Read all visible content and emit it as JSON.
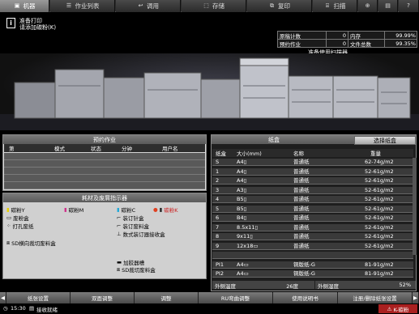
{
  "tabs": [
    {
      "label": "机器",
      "icon": "machine-icon"
    },
    {
      "label": "作业列表",
      "icon": "list-icon"
    },
    {
      "label": "调用",
      "icon": "recall-icon"
    },
    {
      "label": "存储",
      "icon": "store-icon"
    },
    {
      "label": "复印",
      "icon": "copy-icon"
    },
    {
      "label": "扫描",
      "icon": "scan-icon"
    }
  ],
  "message": {
    "line1": "准备打印",
    "line2": "请添加碳粉(K)"
  },
  "stats": {
    "orig_label": "原稿计数",
    "orig_value": "0",
    "mem_label": "内存",
    "mem_value": "99.99%",
    "reserve_label": "预约作业",
    "reserve_value": "0",
    "file_label": "文件总数",
    "file_value": "99.35%"
  },
  "scanner_status": "准备使用扫描器",
  "reserved_panel": {
    "title": "预约作业",
    "columns": [
      "第",
      "模式",
      "状态",
      "分钟",
      "用户名"
    ]
  },
  "consumables_panel": {
    "title": "耗材及废屑指示器",
    "toner_y": "碳粉Y",
    "toner_m": "碳粉M",
    "toner_c": "碳粉C",
    "toner_k": "碳粉K",
    "waste_toner": "废粉盒",
    "staple": "装订针盒",
    "punch": "打孔废纸",
    "staple_waste": "装订废料盒",
    "booklet": "数式装订器接收盒",
    "trim": "SD横向裁切废料盒",
    "glue": "加胶器槽",
    "sd_trim": "SD裁切废料盒"
  },
  "tray_panel": {
    "title": "纸盒",
    "select_label": "选择纸盒",
    "columns": [
      "纸盒",
      "大小(mm)",
      "名称",
      "重量"
    ],
    "rows": [
      {
        "tray": "S",
        "size": "A4▯",
        "name": "普通纸",
        "weight": "62-74g/m2"
      },
      {
        "tray": "1",
        "size": "A4▯",
        "name": "普通纸",
        "weight": "52-61g/m2"
      },
      {
        "tray": "2",
        "size": "A4▯",
        "name": "普通纸",
        "weight": "52-61g/m2"
      },
      {
        "tray": "3",
        "size": "A3▯",
        "name": "普通纸",
        "weight": "52-61g/m2"
      },
      {
        "tray": "4",
        "size": "B5▯",
        "name": "普通纸",
        "weight": "52-61g/m2"
      },
      {
        "tray": "5",
        "size": "B5▯",
        "name": "普通纸",
        "weight": "52-61g/m2"
      },
      {
        "tray": "6",
        "size": "B4▯",
        "name": "普通纸",
        "weight": "52-61g/m2"
      },
      {
        "tray": "7",
        "size": "8.5x11▯",
        "name": "普通纸",
        "weight": "52-61g/m2"
      },
      {
        "tray": "8",
        "size": "9x11▯",
        "name": "普通纸",
        "weight": "52-61g/m2"
      },
      {
        "tray": "9",
        "size": "12x18▭",
        "name": "普通纸",
        "weight": "52-61g/m2"
      },
      {
        "tray": "",
        "size": "",
        "name": "",
        "weight": ""
      },
      {
        "tray": "PI1",
        "size": "A4▭",
        "name": "铜版纸-G",
        "weight": "81-91g/m2"
      },
      {
        "tray": "PI2",
        "size": "A4▭",
        "name": "铜版纸-G",
        "weight": "81-91g/m2"
      }
    ],
    "temp_label": "外侧温度",
    "temp_value": "26度",
    "hum_label": "外侧湿度",
    "hum_value": "52%"
  },
  "bottom_buttons": [
    "纸张设置",
    "双面调整",
    "调整",
    "RU弯曲调整",
    "使用说明书",
    "注册/删除纸张设置"
  ],
  "status": {
    "time": "15:30",
    "text": "接收就绪",
    "toner_warning": "K-碳粉"
  },
  "colors": {
    "accent": "#cc2222",
    "toner_y": "#e8d000",
    "toner_m": "#d0308a",
    "toner_c": "#20a8d8",
    "toner_k": "#222222"
  }
}
